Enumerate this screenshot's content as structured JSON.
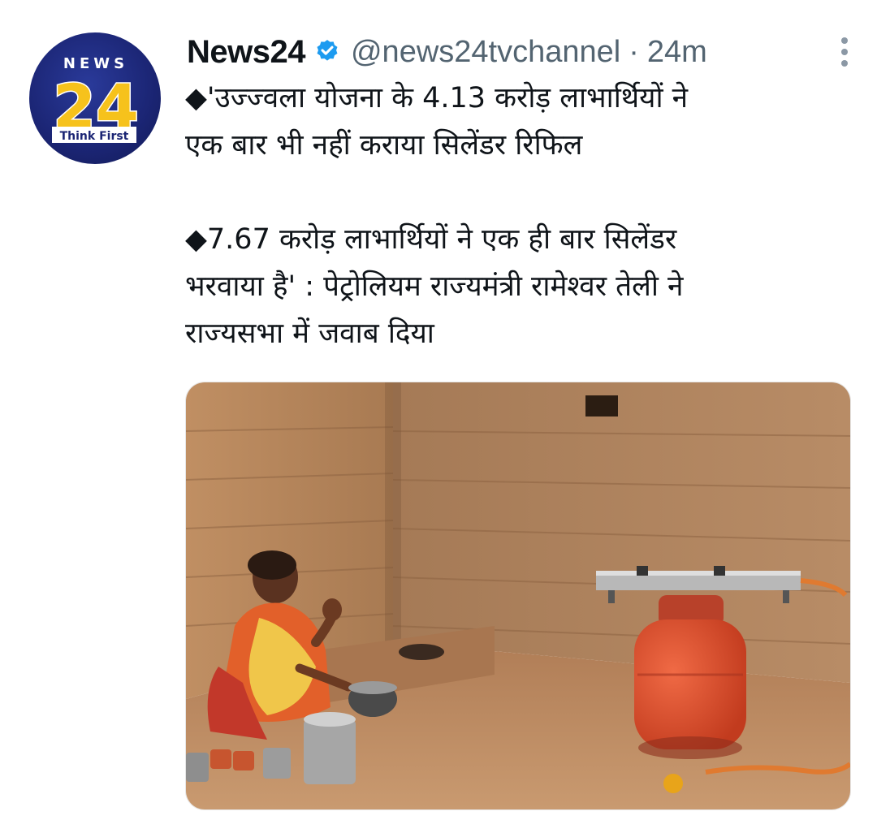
{
  "tweet": {
    "avatar": {
      "logo_top": "NEWS",
      "logo_number": "24",
      "logo_tagline": "Think First"
    },
    "author": {
      "display_name": "News24",
      "handle": "@news24tvchannel",
      "separator": "·",
      "time": "24m"
    },
    "text": {
      "para1_line1": "◆'उज्ज्वला योजना के 4.13 करोड़ लाभार्थियों ने",
      "para1_line2": "एक बार भी नहीं कराया सिलेंडर रिफिल",
      "para2_line1": "◆7.67 करोड़ लाभार्थियों ने एक ही बार सिलेंडर",
      "para2_line2": "भरवाया है' : पेट्रोलियम राज्यमंत्री रामेश्वर तेली ने",
      "para2_line3": "राज्यसभा में जवाब दिया"
    },
    "icons": {
      "verified": "verified-badge-icon",
      "more": "more-vertical-icon"
    },
    "colors": {
      "verified_blue": "#1d9bf0",
      "text_primary": "#0f1419",
      "text_secondary": "#536471",
      "logo_blue": "#1b2574",
      "logo_yellow": "#f6c21c",
      "cylinder_red": "#d9482b"
    }
  }
}
